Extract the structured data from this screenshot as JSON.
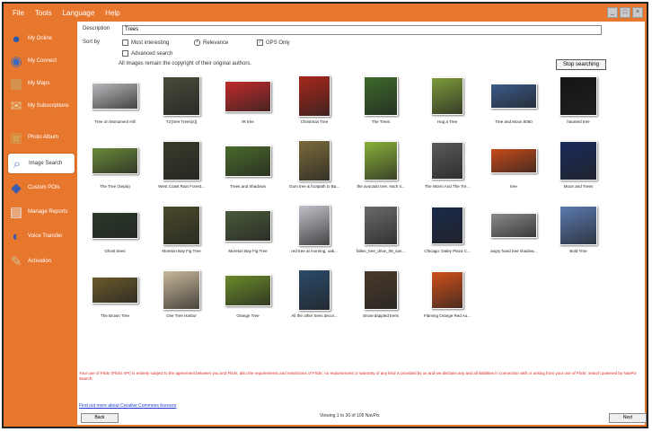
{
  "menu": [
    "File",
    "Tools",
    "Language",
    "Help"
  ],
  "sidebar": [
    {
      "label": "My Online",
      "icon": "globe-icon",
      "active": false
    },
    {
      "label": "My Connect",
      "icon": "connect-icon",
      "active": false
    },
    {
      "label": "My Maps",
      "icon": "map-icon",
      "active": false
    },
    {
      "label": "My Subscriptions",
      "icon": "subscriptions-icon",
      "active": false
    },
    {
      "label": "Photo Album",
      "icon": "album-icon",
      "active": false
    },
    {
      "label": "Image Search",
      "icon": "image-search-icon",
      "active": true
    },
    {
      "label": "Custom POIs",
      "icon": "poi-icon",
      "active": false
    },
    {
      "label": "Manage Reports",
      "icon": "reports-icon",
      "active": false
    },
    {
      "label": "Voice Transfer",
      "icon": "voice-icon",
      "active": false
    },
    {
      "label": "Activation",
      "icon": "activation-icon",
      "active": false
    }
  ],
  "search": {
    "description_label": "Description",
    "description_value": "Trees",
    "sort_label": "Sort by",
    "sort_options": [
      "Most interesting",
      "Relevance"
    ],
    "sort_selected": "Relevance",
    "gps_label": "GPS Only",
    "gps_checked": true,
    "advanced_label": "Advanced search",
    "copyright_note": "All images remain the copyright of their original authors.",
    "stop_button": "Stop searching"
  },
  "images": [
    {
      "caption": "Tree on Monument Hill",
      "color": "#b8b8bc"
    },
    {
      "caption": "T3 [tree Trees(s)]",
      "color": "#4a4a3a"
    },
    {
      "caption": "IR tree",
      "color": "#c22a2a"
    },
    {
      "caption": "Christmas Tree",
      "color": "#a8261a"
    },
    {
      "caption": "The Trees",
      "color": "#3c6a2a"
    },
    {
      "caption": "Hug a Tree",
      "color": "#7c9a3a"
    },
    {
      "caption": "Tree and Moon 8060",
      "color": "#3a5a8a"
    },
    {
      "caption": "haunted tree",
      "color": "#151515"
    },
    {
      "caption": "The Tree (Sepia)",
      "color": "#6a8a3a"
    },
    {
      "caption": "West Coast Rain Forest...",
      "color": "#3a3a2a"
    },
    {
      "caption": "Trees and Shadows",
      "color": "#4a6a2a"
    },
    {
      "caption": "Gum tree & footpath to Ba...",
      "color": "#7a6a3a"
    },
    {
      "caption": "the avocado tree. each ti...",
      "color": "#8ab03a"
    },
    {
      "caption": "The Worm And The Tre...",
      "color": "#5a5a5a"
    },
    {
      "caption": "tree",
      "color": "#c84a1a"
    },
    {
      "caption": "Moon and Trees",
      "color": "#1a2a5a"
    },
    {
      "caption": "Ghost trees",
      "color": "#2a3a2a"
    },
    {
      "caption": "Moreton Bay Fig Tree",
      "color": "#4a4a2a"
    },
    {
      "caption": "Moreton Bay Fig Tree",
      "color": "#4a5a3a"
    },
    {
      "caption": "red tree at morning, oak...",
      "color": "#c0c0c8"
    },
    {
      "caption": "fallen_tree_drive_09_san...",
      "color": "#6a6a6a"
    },
    {
      "caption": "Chicago: Daley Plaza C...",
      "color": "#1a2a4a"
    },
    {
      "caption": "angry hand tree shadow...",
      "color": "#8a8a8a"
    },
    {
      "caption": "Bold Tree",
      "color": "#5a7ab0"
    },
    {
      "caption": "The Brown Tree",
      "color": "#6a5a2a"
    },
    {
      "caption": "One Tree Harbor",
      "color": "#c8b89a"
    },
    {
      "caption": "Orange Tree",
      "color": "#6a8a2a"
    },
    {
      "caption": "All the other trees decor...",
      "color": "#2a4a6a"
    },
    {
      "caption": "Snow-dappled trees",
      "color": "#4a3a2a"
    },
    {
      "caption": "Flaming Orange Red Au...",
      "color": "#d0501a"
    }
  ],
  "legal_text": "Your use of Flickr (Flickr API) is entirely subject to the agreement between you and Flickr, also the requirements and restrictions of Flickr; no endorsement or warranty of any kind is provided by us and we disclaim any and all liabilities in connection with or arising from your use of Flickr; search powered by NavPix Search.",
  "cc_link": "Find out more about Creative Commons licences",
  "footer": {
    "back": "Back",
    "status": "Viewing 1 to 30 of 105 NavPix",
    "next": "Next"
  }
}
